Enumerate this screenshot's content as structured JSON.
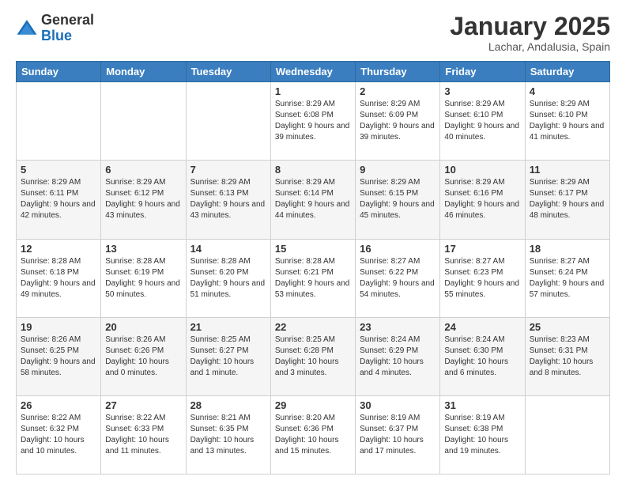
{
  "header": {
    "logo_general": "General",
    "logo_blue": "Blue",
    "month_year": "January 2025",
    "location": "Lachar, Andalusia, Spain"
  },
  "weekdays": [
    "Sunday",
    "Monday",
    "Tuesday",
    "Wednesday",
    "Thursday",
    "Friday",
    "Saturday"
  ],
  "weeks": [
    [
      {
        "day": "",
        "info": ""
      },
      {
        "day": "",
        "info": ""
      },
      {
        "day": "",
        "info": ""
      },
      {
        "day": "1",
        "info": "Sunrise: 8:29 AM\nSunset: 6:08 PM\nDaylight: 9 hours and 39 minutes."
      },
      {
        "day": "2",
        "info": "Sunrise: 8:29 AM\nSunset: 6:09 PM\nDaylight: 9 hours and 39 minutes."
      },
      {
        "day": "3",
        "info": "Sunrise: 8:29 AM\nSunset: 6:10 PM\nDaylight: 9 hours and 40 minutes."
      },
      {
        "day": "4",
        "info": "Sunrise: 8:29 AM\nSunset: 6:10 PM\nDaylight: 9 hours and 41 minutes."
      }
    ],
    [
      {
        "day": "5",
        "info": "Sunrise: 8:29 AM\nSunset: 6:11 PM\nDaylight: 9 hours and 42 minutes."
      },
      {
        "day": "6",
        "info": "Sunrise: 8:29 AM\nSunset: 6:12 PM\nDaylight: 9 hours and 43 minutes."
      },
      {
        "day": "7",
        "info": "Sunrise: 8:29 AM\nSunset: 6:13 PM\nDaylight: 9 hours and 43 minutes."
      },
      {
        "day": "8",
        "info": "Sunrise: 8:29 AM\nSunset: 6:14 PM\nDaylight: 9 hours and 44 minutes."
      },
      {
        "day": "9",
        "info": "Sunrise: 8:29 AM\nSunset: 6:15 PM\nDaylight: 9 hours and 45 minutes."
      },
      {
        "day": "10",
        "info": "Sunrise: 8:29 AM\nSunset: 6:16 PM\nDaylight: 9 hours and 46 minutes."
      },
      {
        "day": "11",
        "info": "Sunrise: 8:29 AM\nSunset: 6:17 PM\nDaylight: 9 hours and 48 minutes."
      }
    ],
    [
      {
        "day": "12",
        "info": "Sunrise: 8:28 AM\nSunset: 6:18 PM\nDaylight: 9 hours and 49 minutes."
      },
      {
        "day": "13",
        "info": "Sunrise: 8:28 AM\nSunset: 6:19 PM\nDaylight: 9 hours and 50 minutes."
      },
      {
        "day": "14",
        "info": "Sunrise: 8:28 AM\nSunset: 6:20 PM\nDaylight: 9 hours and 51 minutes."
      },
      {
        "day": "15",
        "info": "Sunrise: 8:28 AM\nSunset: 6:21 PM\nDaylight: 9 hours and 53 minutes."
      },
      {
        "day": "16",
        "info": "Sunrise: 8:27 AM\nSunset: 6:22 PM\nDaylight: 9 hours and 54 minutes."
      },
      {
        "day": "17",
        "info": "Sunrise: 8:27 AM\nSunset: 6:23 PM\nDaylight: 9 hours and 55 minutes."
      },
      {
        "day": "18",
        "info": "Sunrise: 8:27 AM\nSunset: 6:24 PM\nDaylight: 9 hours and 57 minutes."
      }
    ],
    [
      {
        "day": "19",
        "info": "Sunrise: 8:26 AM\nSunset: 6:25 PM\nDaylight: 9 hours and 58 minutes."
      },
      {
        "day": "20",
        "info": "Sunrise: 8:26 AM\nSunset: 6:26 PM\nDaylight: 10 hours and 0 minutes."
      },
      {
        "day": "21",
        "info": "Sunrise: 8:25 AM\nSunset: 6:27 PM\nDaylight: 10 hours and 1 minute."
      },
      {
        "day": "22",
        "info": "Sunrise: 8:25 AM\nSunset: 6:28 PM\nDaylight: 10 hours and 3 minutes."
      },
      {
        "day": "23",
        "info": "Sunrise: 8:24 AM\nSunset: 6:29 PM\nDaylight: 10 hours and 4 minutes."
      },
      {
        "day": "24",
        "info": "Sunrise: 8:24 AM\nSunset: 6:30 PM\nDaylight: 10 hours and 6 minutes."
      },
      {
        "day": "25",
        "info": "Sunrise: 8:23 AM\nSunset: 6:31 PM\nDaylight: 10 hours and 8 minutes."
      }
    ],
    [
      {
        "day": "26",
        "info": "Sunrise: 8:22 AM\nSunset: 6:32 PM\nDaylight: 10 hours and 10 minutes."
      },
      {
        "day": "27",
        "info": "Sunrise: 8:22 AM\nSunset: 6:33 PM\nDaylight: 10 hours and 11 minutes."
      },
      {
        "day": "28",
        "info": "Sunrise: 8:21 AM\nSunset: 6:35 PM\nDaylight: 10 hours and 13 minutes."
      },
      {
        "day": "29",
        "info": "Sunrise: 8:20 AM\nSunset: 6:36 PM\nDaylight: 10 hours and 15 minutes."
      },
      {
        "day": "30",
        "info": "Sunrise: 8:19 AM\nSunset: 6:37 PM\nDaylight: 10 hours and 17 minutes."
      },
      {
        "day": "31",
        "info": "Sunrise: 8:19 AM\nSunset: 6:38 PM\nDaylight: 10 hours and 19 minutes."
      },
      {
        "day": "",
        "info": ""
      }
    ]
  ]
}
